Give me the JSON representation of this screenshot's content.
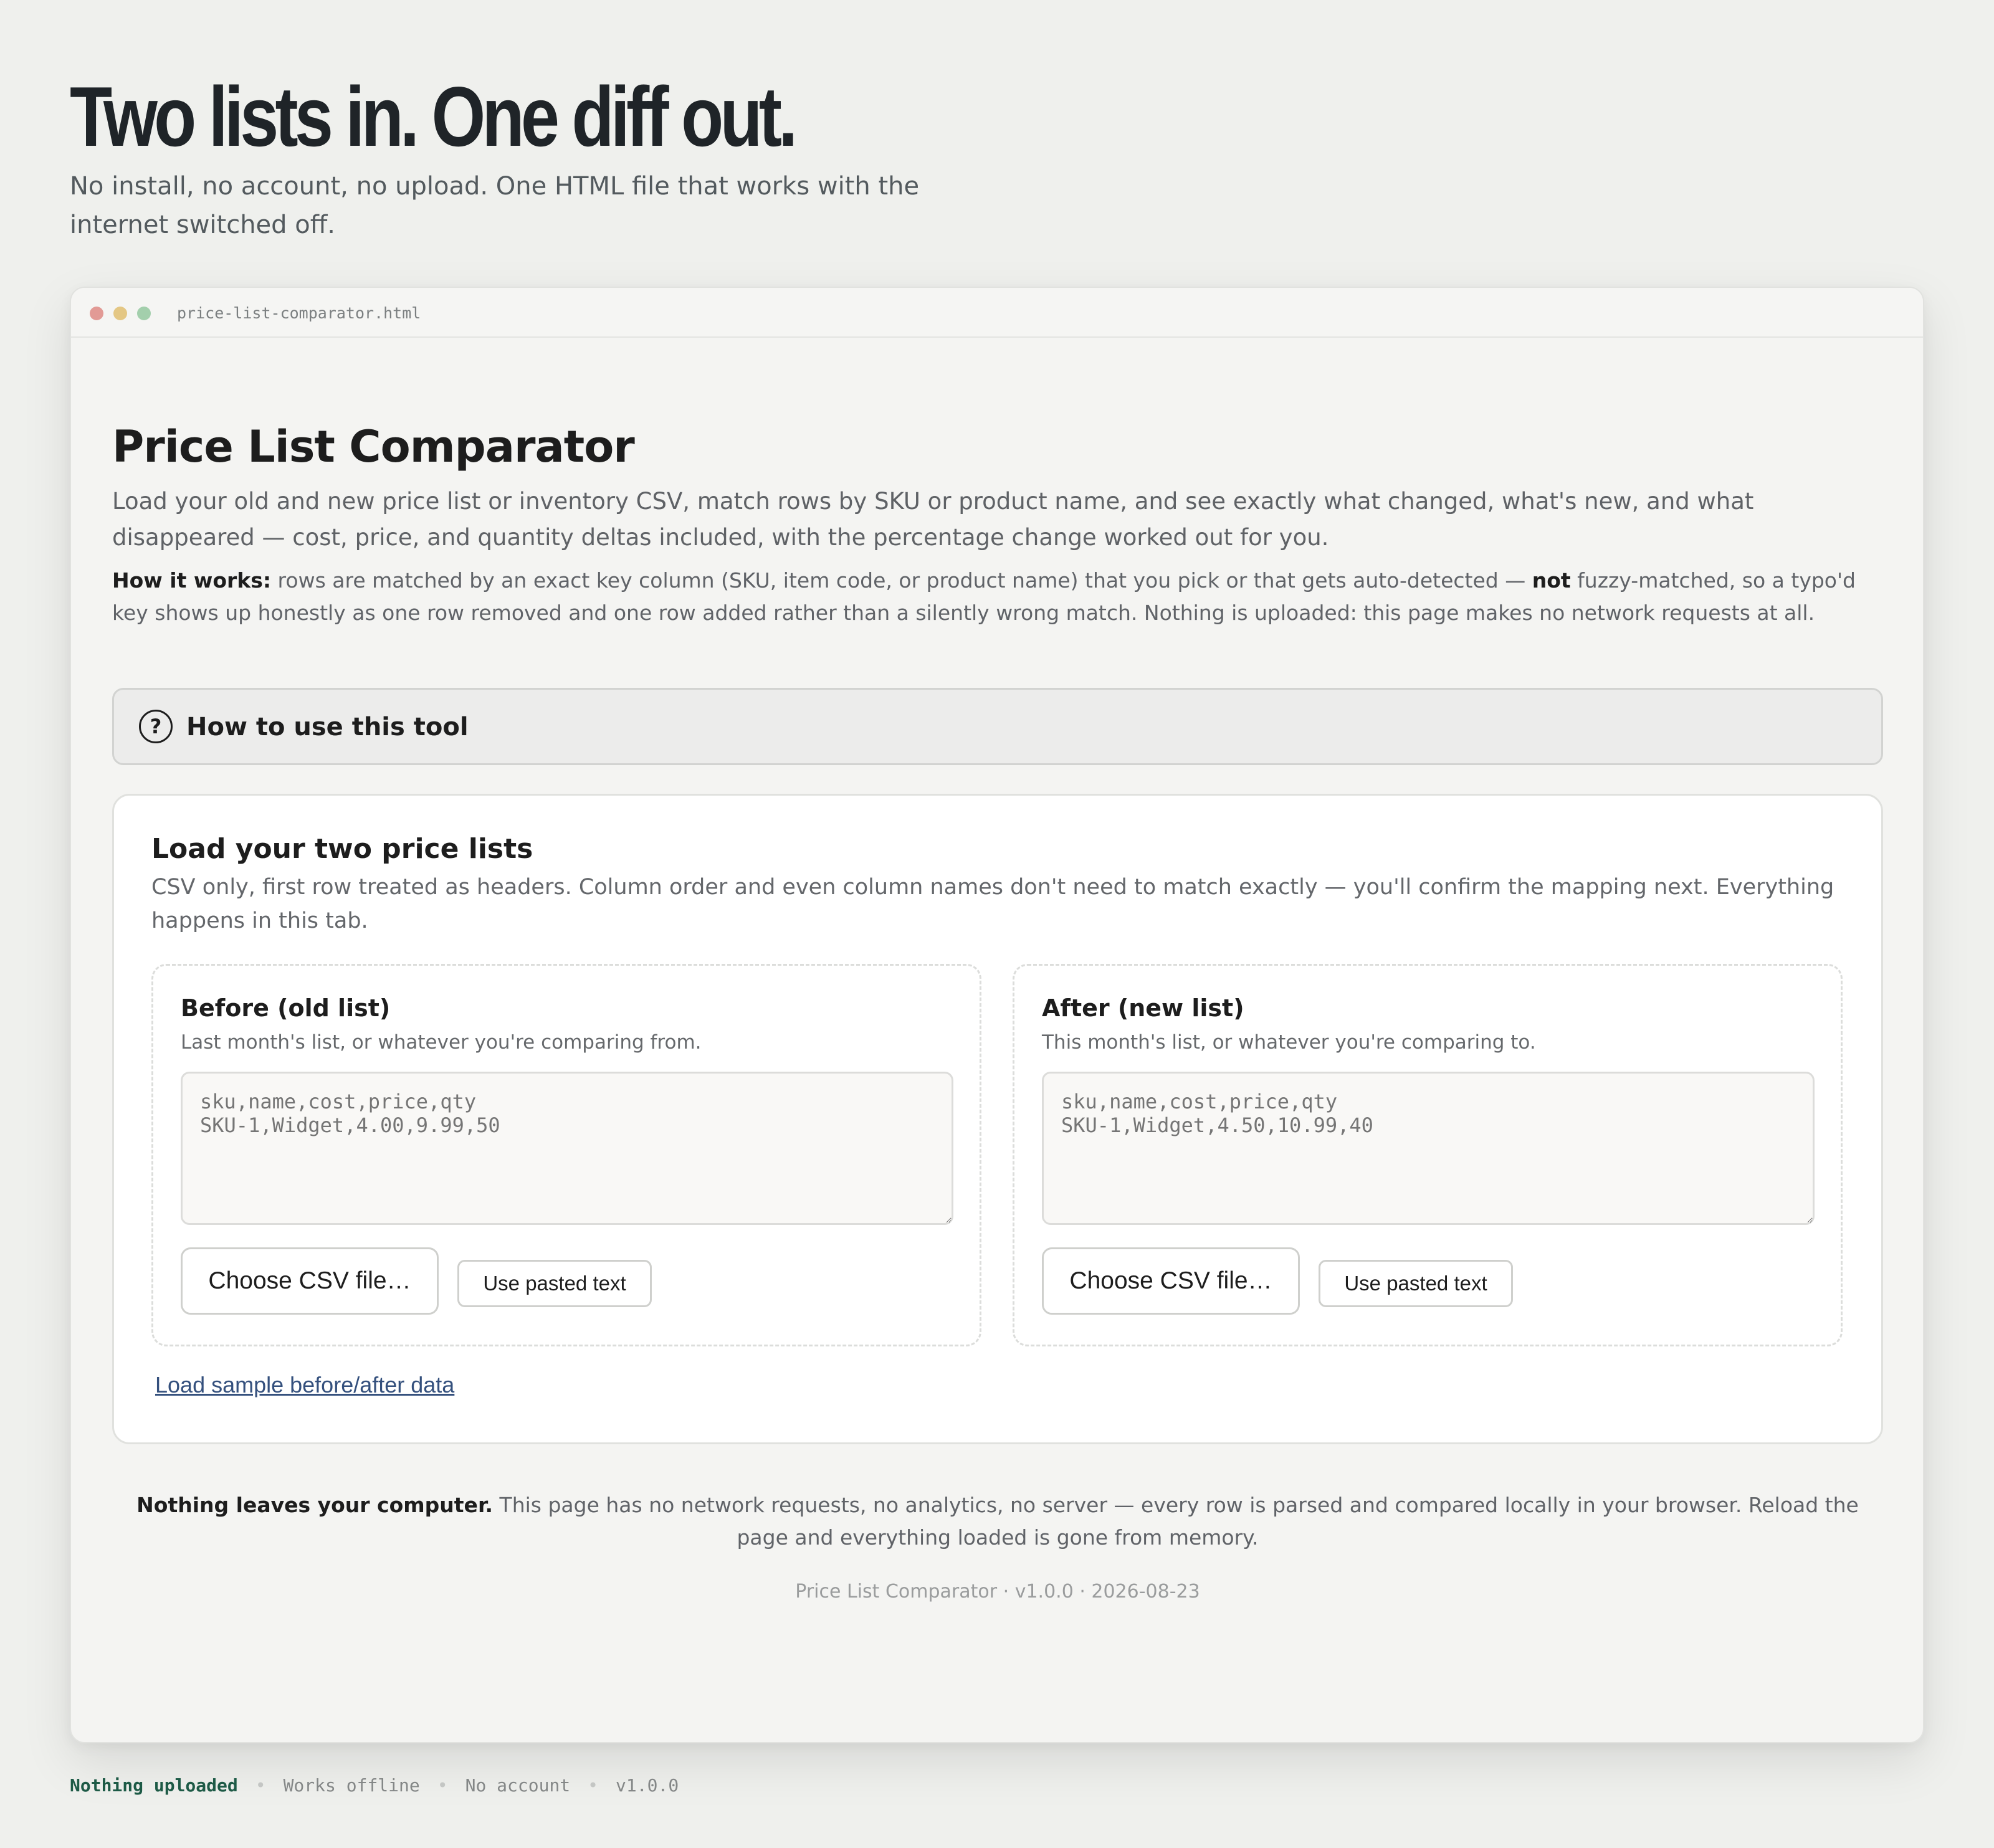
{
  "hero": {
    "title": "Two lists in. One diff out.",
    "subtitle": "No install, no account, no upload. One HTML file that works with the internet switched off."
  },
  "window": {
    "filename": "price-list-comparator.html"
  },
  "app": {
    "title": "Price List Comparator",
    "description": "Load your old and new price list or inventory CSV, match rows by SKU or product name, and see exactly what changed, what's new, and what disappeared — cost, price, and quantity deltas included, with the percentage change worked out for you.",
    "how_label": "How it works:",
    "how_text_1": " rows are matched by an exact key column (SKU, item code, or product name) that you pick or that gets auto-detected — ",
    "how_not": "not",
    "how_text_2": " fuzzy-matched, so a typo'd key shows up honestly as one row removed and one row added rather than a silently wrong match. Nothing is uploaded: this page makes no network requests at all."
  },
  "howto": {
    "icon": "?",
    "label": "How to use this tool"
  },
  "load": {
    "title": "Load your two price lists",
    "description": "CSV only, first row treated as headers. Column order and even column names don't need to match exactly — you'll confirm the mapping next. Everything happens in this tab.",
    "before": {
      "title": "Before (old list)",
      "subtitle": "Last month's list, or whatever you're comparing from.",
      "placeholder": "sku,name,cost,price,qty\nSKU-1,Widget,4.00,9.99,50",
      "choose_label": "Choose CSV file…",
      "use_label": "Use pasted text"
    },
    "after": {
      "title": "After (new list)",
      "subtitle": "This month's list, or whatever you're comparing to.",
      "placeholder": "sku,name,cost,price,qty\nSKU-1,Widget,4.50,10.99,40",
      "choose_label": "Choose CSV file…",
      "use_label": "Use pasted text"
    },
    "sample_link": "Load sample before/after data"
  },
  "privacy": {
    "bold": "Nothing leaves your computer.",
    "text": " This page has no network requests, no analytics, no server — every row is parsed and compared locally in your browser. Reload the page and everything loaded is gone from memory."
  },
  "version_line": "Price List Comparator · v1.0.0 · 2026-08-23",
  "status_bar": {
    "items": [
      "Nothing uploaded",
      "Works offline",
      "No account",
      "v1.0.0"
    ],
    "separator": "•"
  },
  "colors": {
    "background": "#eff0ed",
    "link": "#34507d",
    "status_active": "#1d5a46"
  }
}
